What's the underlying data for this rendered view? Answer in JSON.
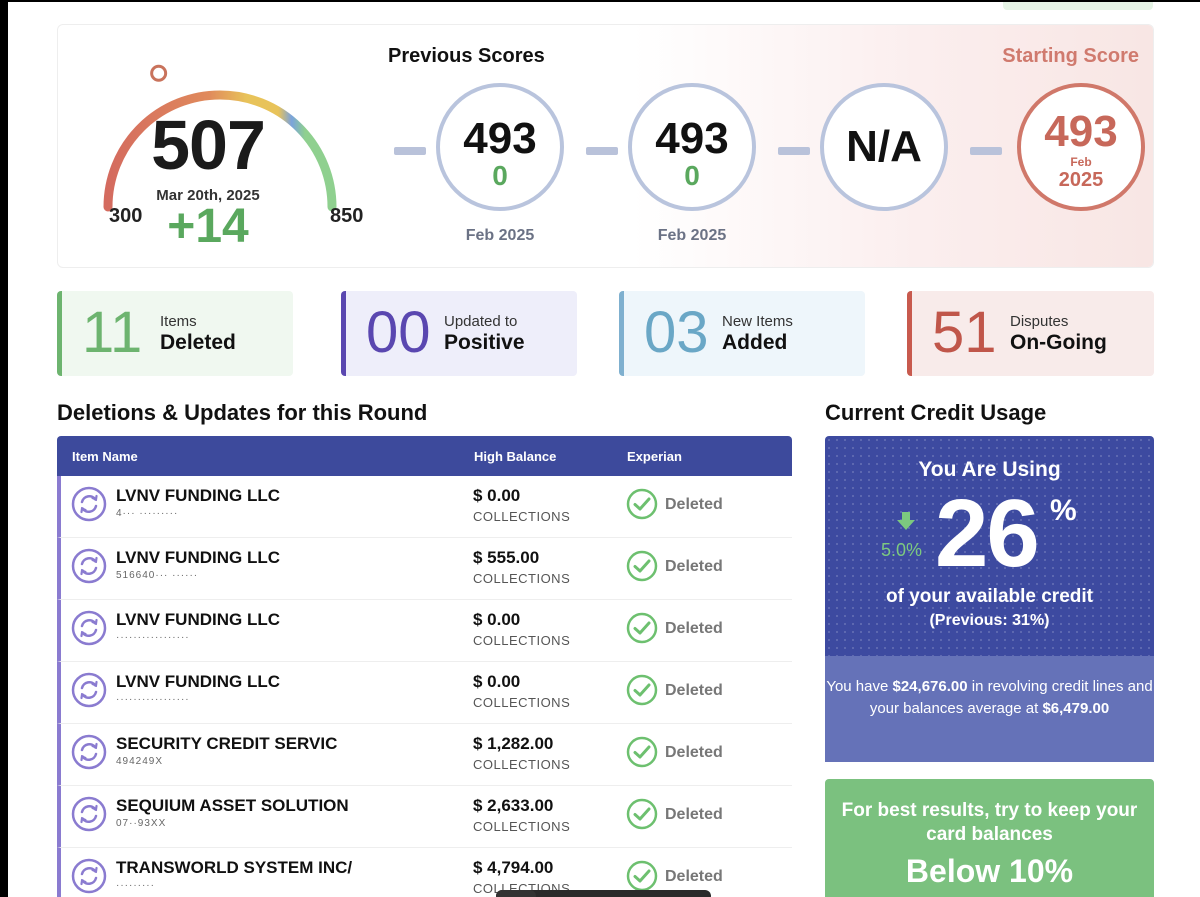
{
  "score": {
    "current": "507",
    "date": "Mar 20th, 2025",
    "change": "+14",
    "min": "300",
    "max": "850",
    "fill_fraction": 0.377
  },
  "previous": {
    "title": "Previous Scores",
    "items": [
      {
        "value": "493",
        "change": "0",
        "date": "Feb 2025"
      },
      {
        "value": "493",
        "change": "0",
        "date": "Feb 2025"
      },
      {
        "value": "N/A"
      }
    ]
  },
  "starting": {
    "title": "Starting Score",
    "value": "493",
    "month": "Feb",
    "year": "2025"
  },
  "stats": [
    {
      "num": "11",
      "label1": "Items",
      "label2": "Deleted"
    },
    {
      "num": "00",
      "label1": "Updated to",
      "label2": "Positive"
    },
    {
      "num": "03",
      "label1": "New Items",
      "label2": "Added"
    },
    {
      "num": "51",
      "label1": "Disputes",
      "label2": "On-Going"
    }
  ],
  "table": {
    "title": "Deletions & Updates for this Round",
    "headers": {
      "name": "Item Name",
      "balance": "High Balance",
      "bureau": "Experian"
    },
    "rows": [
      {
        "name": "LVNV FUNDING LLC",
        "acct": "4··· ·········",
        "balance": "$ 0.00",
        "type": "COLLECTIONS",
        "status": "Deleted"
      },
      {
        "name": "LVNV FUNDING LLC",
        "acct": "516640··· ······",
        "balance": "$ 555.00",
        "type": "COLLECTIONS",
        "status": "Deleted"
      },
      {
        "name": "LVNV FUNDING LLC",
        "acct": "·················",
        "balance": "$ 0.00",
        "type": "COLLECTIONS",
        "status": "Deleted"
      },
      {
        "name": "LVNV FUNDING LLC",
        "acct": "·················",
        "balance": "$ 0.00",
        "type": "COLLECTIONS",
        "status": "Deleted"
      },
      {
        "name": "SECURITY CREDIT SERVIC",
        "acct": "494249X",
        "balance": "$ 1,282.00",
        "type": "COLLECTIONS",
        "status": "Deleted"
      },
      {
        "name": "SEQUIUM ASSET SOLUTION",
        "acct": "07··93XX",
        "balance": "$ 2,633.00",
        "type": "COLLECTIONS",
        "status": "Deleted"
      },
      {
        "name": "TRANSWORLD SYSTEM INC/",
        "acct": "·········",
        "balance": "$ 4,794.00",
        "type": "COLLECTIONS",
        "status": "Deleted"
      }
    ]
  },
  "usage": {
    "title": "Current Credit Usage",
    "using": "You Are Using",
    "percent": "26",
    "percent_symbol": "%",
    "change": "5.0%",
    "caption": "of your available credit",
    "previous": "(Previous: 31%)",
    "foot_pre": "You have ",
    "revolving": "$24,676.00",
    "foot_mid1": " in revolving credit lines and your balances average at ",
    "average": "$6,479.00",
    "tip1": "For best results, try to keep your card balances",
    "tip2": "Below 10%"
  },
  "colors": {
    "navy": "#3d4a9c",
    "green": "#5aa85e",
    "coral": "#c7685a",
    "purple": "#5a47b0",
    "blue": "#6aa7c6"
  }
}
